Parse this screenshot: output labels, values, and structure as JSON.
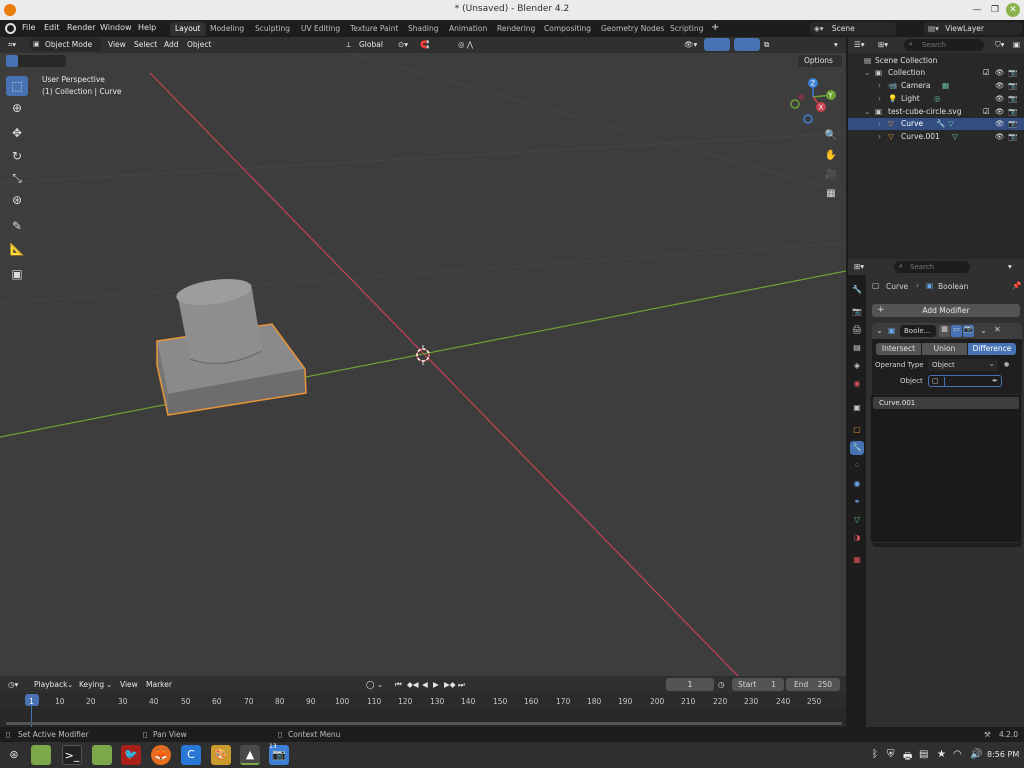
{
  "window": {
    "title": "* (Unsaved) - Blender 4.2"
  },
  "menubar": {
    "items": [
      "File",
      "Edit",
      "Render",
      "Window",
      "Help"
    ],
    "workspace_tabs": [
      "Layout",
      "Modeling",
      "Sculpting",
      "UV Editing",
      "Texture Paint",
      "Shading",
      "Animation",
      "Rendering",
      "Compositing",
      "Geometry Nodes",
      "Scripting"
    ],
    "active_tab": "Layout",
    "scene": "Scene",
    "view_layer": "ViewLayer"
  },
  "viewport_header": {
    "mode": "Object Mode",
    "menus": [
      "View",
      "Select",
      "Add",
      "Object"
    ],
    "transform_orientation": "Global",
    "options_label": "Options"
  },
  "viewport": {
    "view_name": "User Perspective",
    "collection_info": "(1) Collection | Curve",
    "gizmo_axes": [
      "X",
      "Y",
      "Z"
    ]
  },
  "outliner": {
    "search_placeholder": "Search",
    "rows": [
      {
        "label": "Scene Collection"
      },
      {
        "label": "Collection"
      },
      {
        "label": "Camera"
      },
      {
        "label": "Light"
      },
      {
        "label": "test-cube-circle.svg"
      },
      {
        "label": "Curve"
      },
      {
        "label": "Curve.001"
      }
    ]
  },
  "properties": {
    "search_placeholder": "Search",
    "breadcrumb_object": "Curve",
    "breadcrumb_modifier": "Boolean",
    "add_modifier_label": "Add Modifier",
    "modifier_name": "Boole...",
    "operations": [
      "Intersect",
      "Union",
      "Difference"
    ],
    "active_operation": "Difference",
    "operand_type_label": "Operand Type",
    "operand_type_value": "Object",
    "object_label": "Object",
    "object_value": "",
    "dropdown_option": "Curve.001"
  },
  "timeline": {
    "menus": [
      "Playback",
      "Keying",
      "View",
      "Marker"
    ],
    "current_frame": "1",
    "start_label": "Start",
    "start_value": "1",
    "end_label": "End",
    "end_value": "250",
    "ticks": [
      "1",
      "10",
      "20",
      "30",
      "40",
      "50",
      "60",
      "70",
      "80",
      "90",
      "100",
      "110",
      "120",
      "130",
      "140",
      "150",
      "160",
      "170",
      "180",
      "190",
      "200",
      "210",
      "220",
      "230",
      "240",
      "250"
    ]
  },
  "statusbar": {
    "hints": [
      "Set Active Modifier",
      "Pan View",
      "Context Menu"
    ],
    "version": "4.2.0"
  },
  "taskbar": {
    "clock": "8:56 PM",
    "badge": "13"
  },
  "colors": {
    "accent": "#4772b3",
    "selection": "#334d80",
    "x_axis": "#c8424f",
    "y_axis": "#6ea036",
    "z_axis": "#3d7fd6",
    "outline": "#e8953a"
  }
}
